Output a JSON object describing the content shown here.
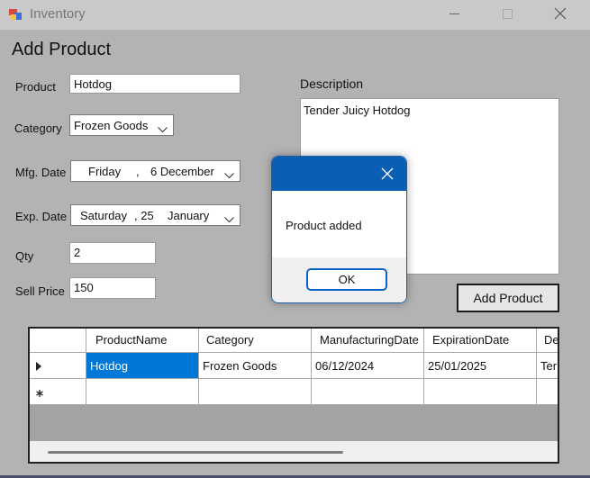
{
  "window": {
    "title": "Inventory"
  },
  "form": {
    "heading": "Add Product",
    "product": {
      "label": "Product",
      "value": "Hotdog"
    },
    "category": {
      "label": "Category",
      "value": "Frozen Goods"
    },
    "mfg_date": {
      "label": "Mfg. Date",
      "day": "Friday",
      "sep": ",",
      "date": "6 December"
    },
    "exp_date": {
      "label": "Exp. Date",
      "day": "Saturday",
      "sep": ", 25",
      "date": "January"
    },
    "qty": {
      "label": "Qty",
      "value": "2"
    },
    "sell_price": {
      "label": "Sell Price",
      "value": "150"
    },
    "description": {
      "label": "Description",
      "value": "Tender Juicy Hotdog"
    },
    "add_button": "Add Product"
  },
  "grid": {
    "columns": [
      "ProductName",
      "Category",
      "ManufacturingDate",
      "ExpirationDate",
      "De"
    ],
    "rows": [
      [
        "Hotdog",
        "Frozen Goods",
        "06/12/2024",
        "25/01/2025",
        "Ter"
      ]
    ]
  },
  "dialog": {
    "message": "Product added",
    "ok": "OK"
  },
  "colors": {
    "accent": "#0a5fb4",
    "selection": "#0078d7",
    "window_bg": "#b3b3b3"
  }
}
